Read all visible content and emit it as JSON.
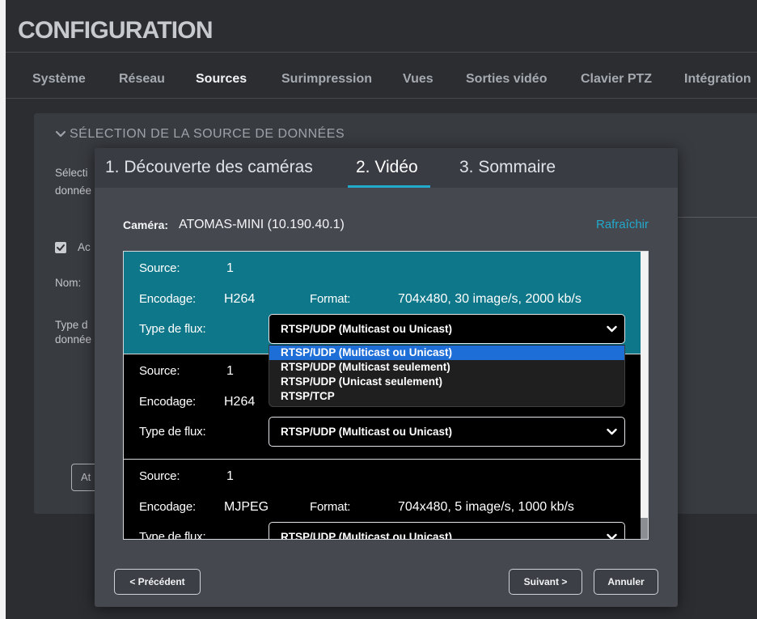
{
  "header": {
    "title": "CONFIGURATION"
  },
  "tabs": [
    {
      "label": "Système"
    },
    {
      "label": "Réseau"
    },
    {
      "label": "Sources",
      "active": true
    },
    {
      "label": "Surimpression"
    },
    {
      "label": "Vues"
    },
    {
      "label": "Sorties vidéo"
    },
    {
      "label": "Clavier PTZ"
    },
    {
      "label": "Intégration"
    }
  ],
  "panel": {
    "title": "SÉLECTION DE LA SOURCE DE DONNÉES",
    "expanded": true,
    "partial_labels": {
      "selection_line1": "Sélecti",
      "selection_line2": "donnée",
      "checkbox": "Ac",
      "name": "Nom:",
      "type_line1": "Type d",
      "type_line2": "donnée",
      "button": "At"
    },
    "checkbox_checked": true
  },
  "wizard": {
    "steps": [
      {
        "label": "1. Découverte des caméras"
      },
      {
        "label": "2. Vidéo",
        "active": true
      },
      {
        "label": "3. Sommaire"
      }
    ],
    "camera_label": "Caméra:",
    "camera_value": "ATOMAS-MINI (10.190.40.1)",
    "refresh_link": "Rafraîchir",
    "labels": {
      "source": "Source:",
      "encoding": "Encodage:",
      "format": "Format:",
      "flow_type": "Type de flux:"
    },
    "streams": [
      {
        "source": "1",
        "encoding": "H264",
        "format": "704x480, 30 image/s, 2000 kb/s",
        "flow_type": "RTSP/UDP (Multicast ou Unicast)",
        "selected": true,
        "dropdown_open": true
      },
      {
        "source": "1",
        "encoding": "H264",
        "flow_type": "RTSP/UDP (Multicast ou Unicast)"
      },
      {
        "source": "1",
        "encoding": "MJPEG",
        "format": "704x480, 5 image/s, 1000 kb/s",
        "flow_type": "RTSP/UDP (Multicast ou Unicast)"
      }
    ],
    "flow_type_options": [
      {
        "label": "RTSP/UDP (Multicast ou Unicast)",
        "highlighted": true
      },
      {
        "label": "RTSP/UDP (Multicast seulement)"
      },
      {
        "label": "RTSP/UDP (Unicast seulement)"
      },
      {
        "label": "RTSP/TCP"
      }
    ],
    "buttons": {
      "previous": "< Précédent",
      "next": "Suivant >",
      "cancel": "Annuler"
    }
  },
  "colors": {
    "accent": "#22a9cb",
    "selected_row": "#0f778a",
    "option_highlight": "#1e6ed8",
    "page_background": "#2b2d31",
    "panel_background": "#383b40",
    "modal_header": "#393c42",
    "modal_body": "#45484f"
  },
  "icons": {
    "panel_toggle": "chevron-down-icon",
    "select_arrow": "chevron-down-icon",
    "checkbox": "check-icon"
  }
}
